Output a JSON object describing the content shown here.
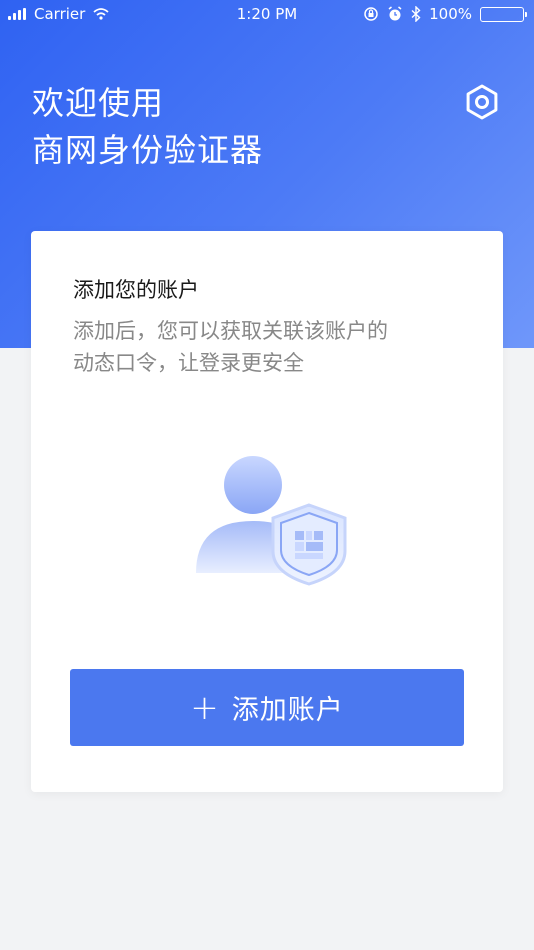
{
  "status_bar": {
    "carrier": "Carrier",
    "time": "1:20 PM",
    "battery": "100%"
  },
  "header": {
    "title_line1": "欢迎使用",
    "title_line2": "商网身份验证器"
  },
  "card": {
    "title": "添加您的账户",
    "description_line1": "添加后，您可以获取关联该账户的",
    "description_line2": "动态口令，让登录更安全",
    "add_button": {
      "icon": "+",
      "label": "添加账户"
    }
  },
  "colors": {
    "brand_blue": "#4b78ef",
    "header_gradient_start": "#2f62f2",
    "header_gradient_end": "#6f97fa",
    "page_background": "#f2f3f5"
  },
  "icons": {
    "settings": "hexagon-settings-icon",
    "illustration": "user-shield-illustration"
  }
}
